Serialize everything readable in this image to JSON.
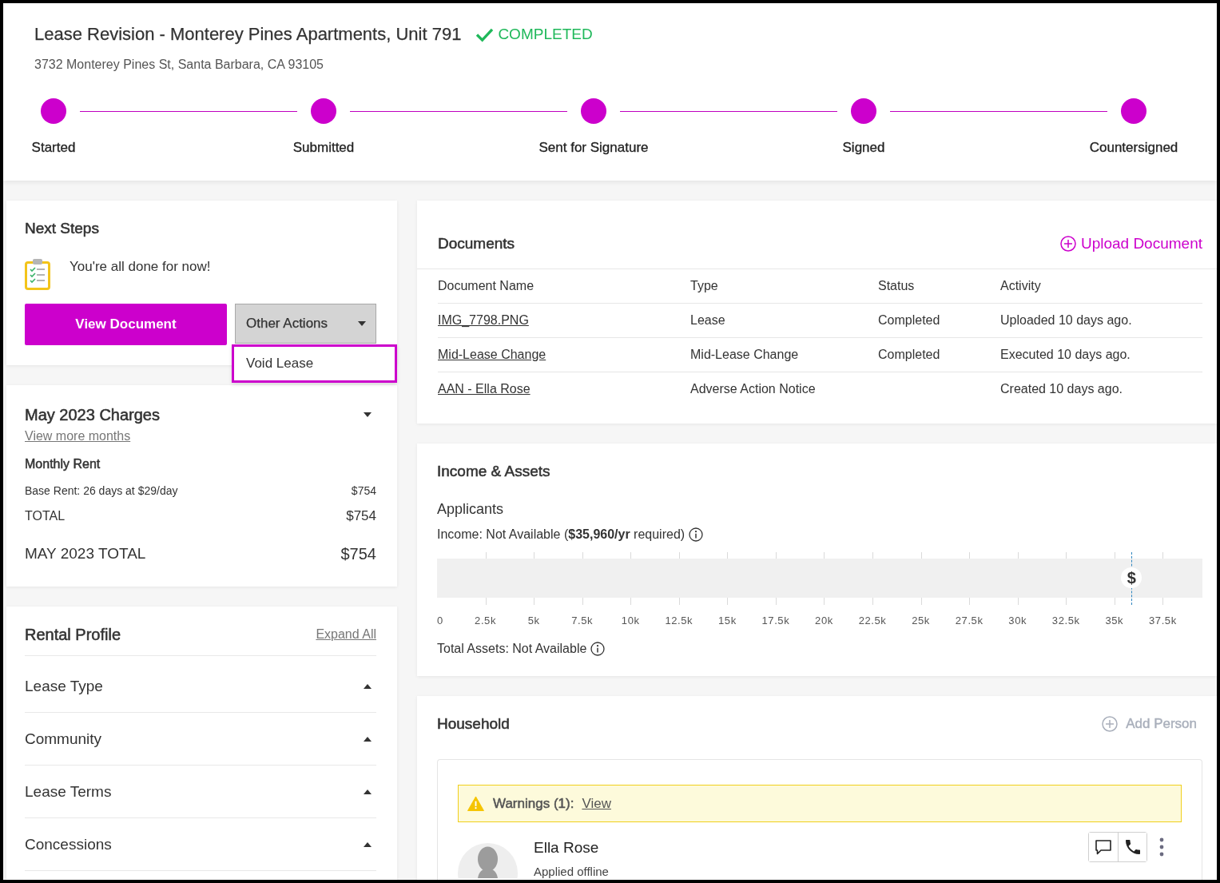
{
  "header": {
    "title": "Lease Revision - Monterey Pines Apartments, Unit 791",
    "status": {
      "label": "COMPLETED",
      "kind": "completed"
    },
    "address": "3732 Monterey Pines St, Santa Barbara, CA 93105"
  },
  "steps": [
    {
      "label": "Started",
      "completed": true
    },
    {
      "label": "Submitted",
      "completed": true
    },
    {
      "label": "Sent for Signature",
      "completed": true
    },
    {
      "label": "Signed",
      "completed": true
    },
    {
      "label": "Countersigned",
      "completed": true
    }
  ],
  "next_steps": {
    "title": "Next Steps",
    "message": "You're all done for now!",
    "primary_button": "View Document",
    "actions_menu": {
      "label": "Other Actions",
      "expanded": true,
      "items": [
        {
          "label": "Void Lease",
          "focused": true
        }
      ]
    }
  },
  "charges": {
    "title": "May 2023 Charges",
    "expanded": true,
    "link": "View more months",
    "section": "Monthly Rent",
    "lines": [
      {
        "label": "Base Rent: 26 days at $29/day",
        "amount": "$754"
      }
    ],
    "total": {
      "label": "TOTAL",
      "amount": "$754"
    },
    "month_total": {
      "label": "MAY 2023 TOTAL",
      "amount": "$754"
    }
  },
  "rental_profile": {
    "title": "Rental Profile",
    "expand_all": "Expand All",
    "sections": [
      {
        "label": "Lease Type",
        "expanded": false
      },
      {
        "label": "Community",
        "expanded": false
      },
      {
        "label": "Lease Terms",
        "expanded": false
      },
      {
        "label": "Concessions",
        "expanded": false
      }
    ]
  },
  "documents": {
    "title": "Documents",
    "upload": "Upload Document",
    "columns": [
      "Document Name",
      "Type",
      "Status",
      "Activity"
    ],
    "rows": [
      {
        "name": "IMG_7798.PNG",
        "type": "Lease",
        "status": "Completed",
        "activity": "Uploaded 10 days ago."
      },
      {
        "name": "Mid-Lease Change",
        "type": "Mid-Lease Change",
        "status": "Completed",
        "activity": "Executed 10 days ago."
      },
      {
        "name": "AAN - Ella Rose",
        "type": "Adverse Action Notice",
        "activity": "Created 10 days ago."
      }
    ]
  },
  "income": {
    "title": "Income & Assets",
    "subtitle": "Applicants",
    "income_text": "Income: Not Available (**$35,960/yr** required)",
    "scale": {
      "ticks": [
        "0",
        "2.5k",
        "5k",
        "7.5k",
        "10k",
        "12.5k",
        "15k",
        "17.5k",
        "20k",
        "22.5k",
        "25k",
        "27.5k",
        "30k",
        "32.5k",
        "35k",
        "37.5k"
      ],
      "marker": {
        "symbol": "$",
        "level": 0.907
      }
    },
    "assets_text": "Total Assets: Not Available"
  },
  "household": {
    "title": "Household",
    "add_person": {
      "label": "Add Person",
      "disabled": true
    },
    "warning": {
      "label": "Warnings (1):",
      "link": "View"
    },
    "members": [
      {
        "name": "Ella Rose",
        "note": "Applied offline"
      }
    ]
  }
}
